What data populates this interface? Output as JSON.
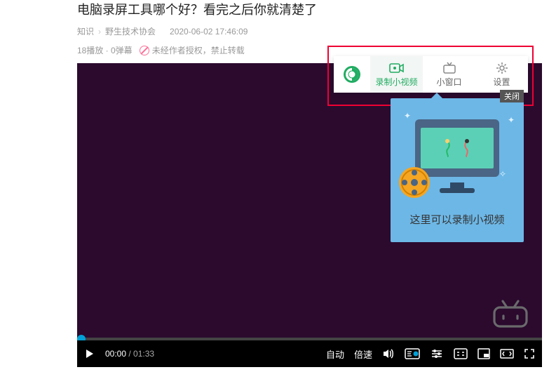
{
  "title": "电脑录屏工具哪个好？看完之后你就清楚了",
  "meta": {
    "category": "知识",
    "subcategory": "野生技术协会",
    "datetime": "2020-06-02 17:46:09"
  },
  "stats": {
    "plays_danmu": "18播放 · 0弹幕",
    "noauth": "未经作者授权，禁止转载"
  },
  "player": {
    "time_current": "00:00",
    "time_total": "01:33",
    "quality": "自动",
    "speed": "倍速"
  },
  "toolbar": {
    "record": "录制小视频",
    "pip": "小窗口",
    "settings": "设置"
  },
  "popup": {
    "close": "关闭",
    "text": "这里可以录制小视频"
  }
}
